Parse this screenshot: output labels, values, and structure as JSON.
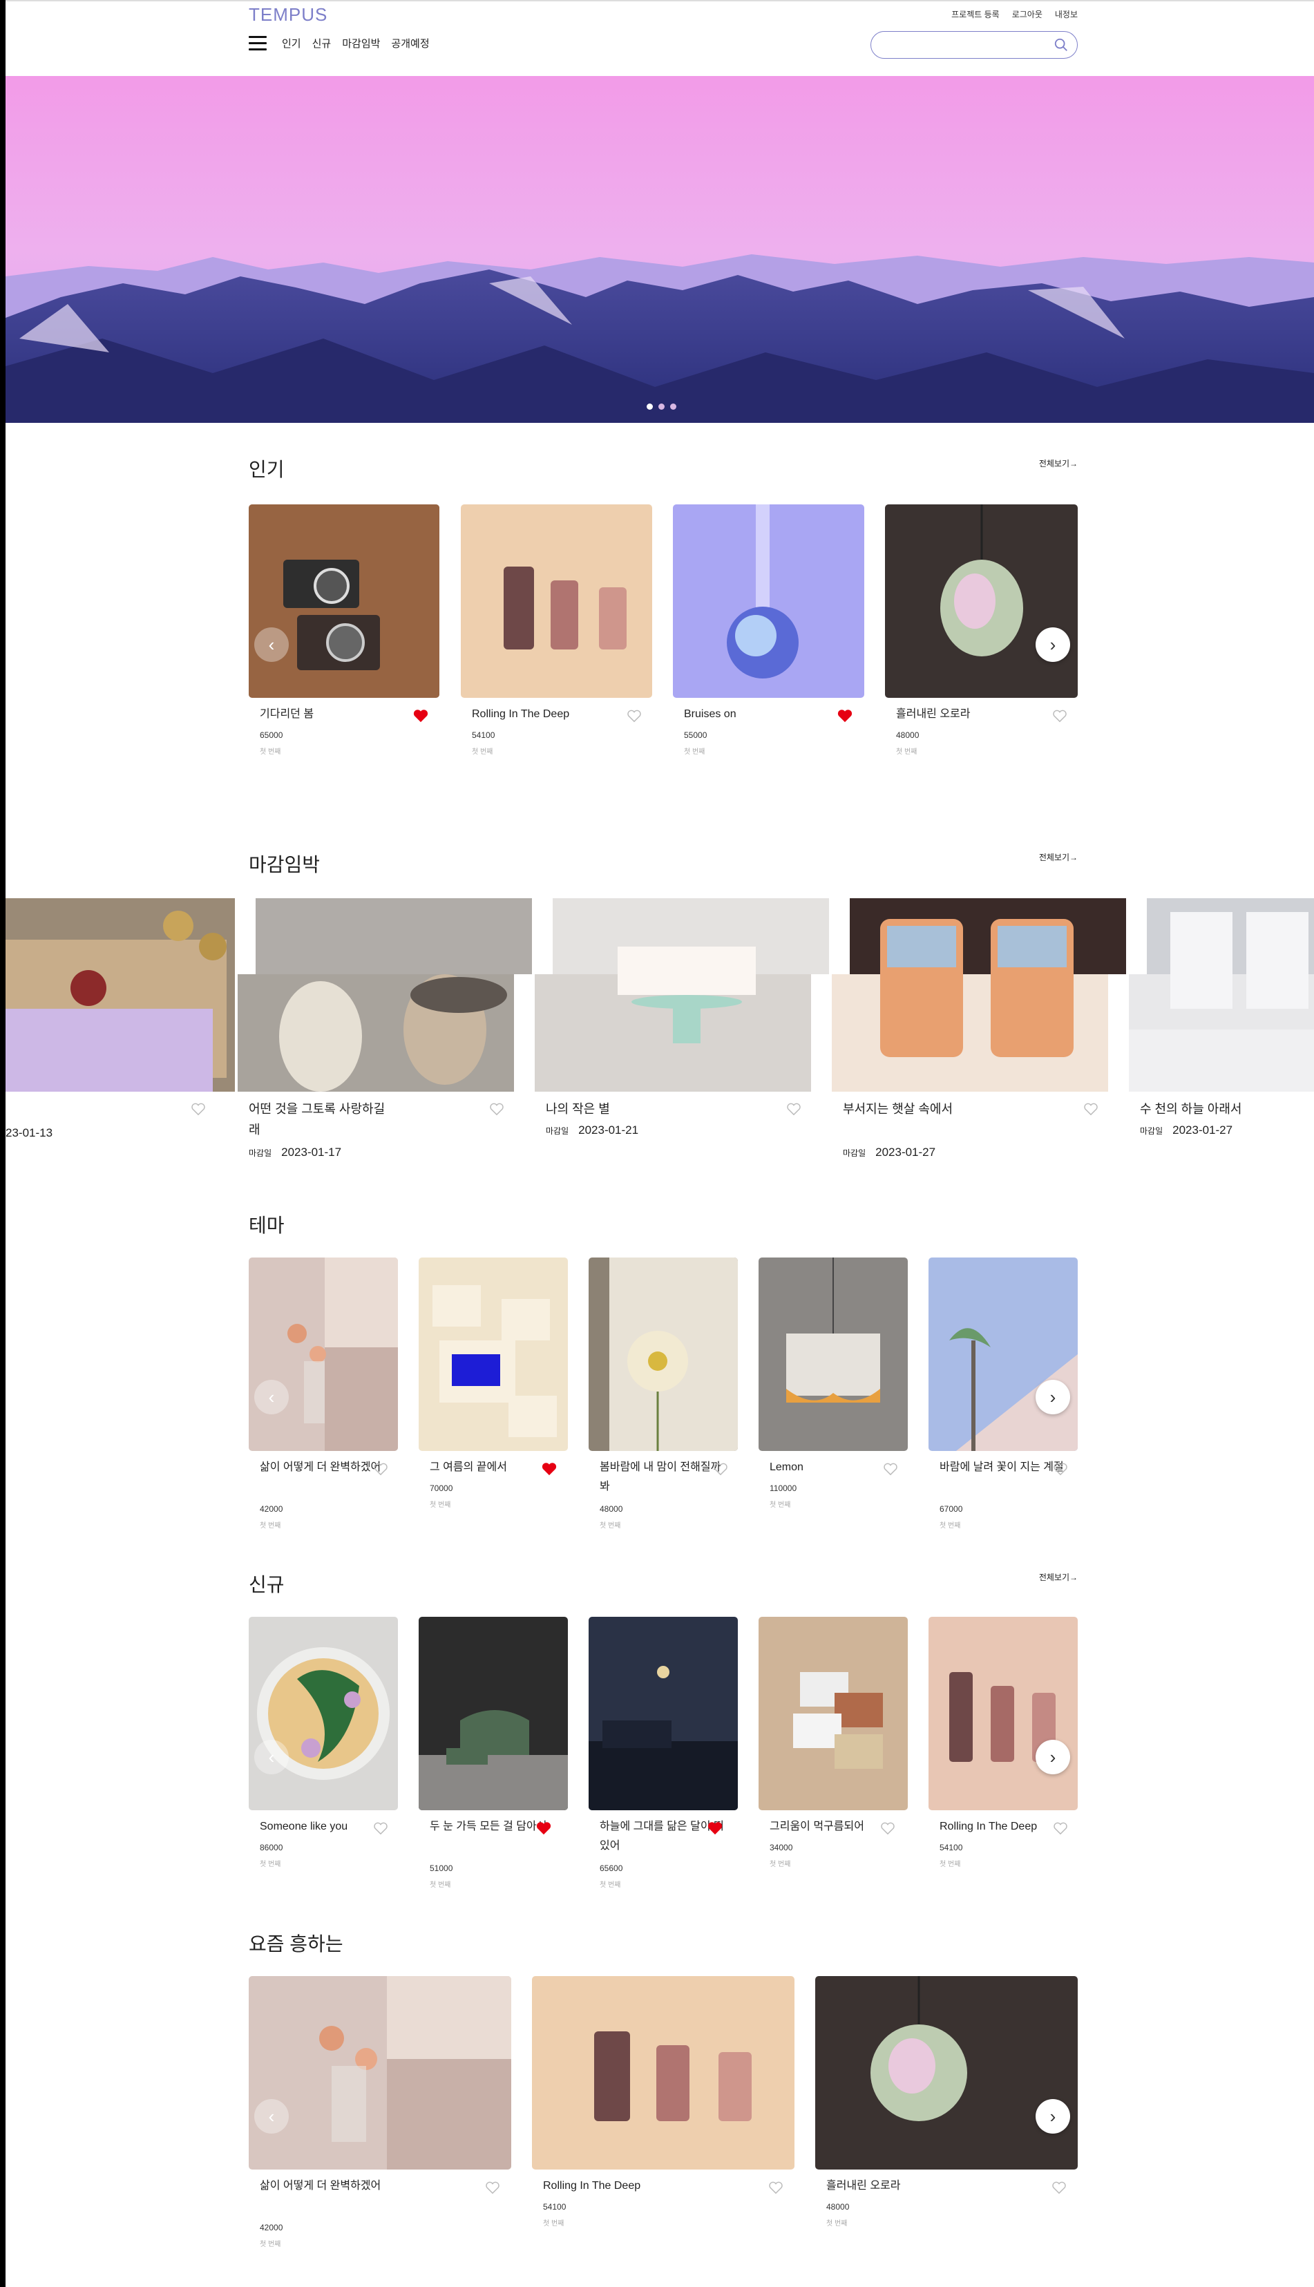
{
  "brand": "TEMPUS",
  "util_links": [
    "프로젝트 등록",
    "로그아웃",
    "내정보"
  ],
  "nav": [
    "인기",
    "신규",
    "마감임박",
    "공개예정"
  ],
  "search": {
    "placeholder": ""
  },
  "colors": {
    "accent": "#7d7fc9",
    "heart_on": "#e60012",
    "heart_off": "#bbbbbb"
  },
  "hero": {
    "slides": 3,
    "active": 0
  },
  "more_label": "전체보기→",
  "sections": {
    "popular": {
      "title": "인기",
      "items": [
        {
          "name": "기다리던 봄",
          "price": "65000",
          "sub": "첫 번째",
          "liked": true
        },
        {
          "name": "Rolling In The Deep",
          "price": "54100",
          "sub": "첫 번째",
          "liked": false
        },
        {
          "name": "Bruises on",
          "price": "55000",
          "sub": "첫 번째",
          "liked": true
        },
        {
          "name": "흘러내린 오로라",
          "price": "48000",
          "sub": "첫 번째",
          "liked": false
        }
      ]
    },
    "deadline": {
      "title": "마감임박",
      "date_label": "마감일",
      "items": [
        {
          "name": "",
          "date": "23-01-13"
        },
        {
          "name": "어떤 것을 그토록 사랑하길래",
          "date": "2023-01-17"
        },
        {
          "name": "나의 작은 별",
          "date": "2023-01-21"
        },
        {
          "name": "부서지는 햇살 속에서",
          "date": "2023-01-27"
        },
        {
          "name": "수 천의 하늘 아래서",
          "date": "2023-01-27"
        }
      ]
    },
    "theme": {
      "title": "테마",
      "items": [
        {
          "name": "삶이 어떻게 더 완벽하겠어",
          "price": "42000",
          "sub": "첫 번째",
          "liked": false
        },
        {
          "name": "그 여름의 끝에서",
          "price": "70000",
          "sub": "첫 번째",
          "liked": true
        },
        {
          "name": "봄바람에 내 맘이 전해질까봐",
          "price": "48000",
          "sub": "첫 번째",
          "liked": false
        },
        {
          "name": "Lemon",
          "price": "110000",
          "sub": "첫 번째",
          "liked": false
        },
        {
          "name": "바람에 날려 꽃이 지는 계절",
          "price": "67000",
          "sub": "첫 번째",
          "liked": false
        }
      ]
    },
    "new": {
      "title": "신규",
      "items": [
        {
          "name": "Someone like you",
          "price": "86000",
          "sub": "첫 번째",
          "liked": false
        },
        {
          "name": "두 눈 가득 모든 걸 담아서",
          "price": "51000",
          "sub": "첫 번째",
          "liked": true
        },
        {
          "name": "하늘에 그대를 닮은 달이 떠있어",
          "price": "65600",
          "sub": "첫 번째",
          "liked": true
        },
        {
          "name": "그리움이 먹구름되어",
          "price": "34000",
          "sub": "첫 번째",
          "liked": false
        },
        {
          "name": "Rolling In The Deep",
          "price": "54100",
          "sub": "첫 번째",
          "liked": false
        }
      ]
    },
    "trending": {
      "title": "요즘 흥하는",
      "items": [
        {
          "name": "삶이 어떻게 더 완벽하겠어",
          "price": "42000",
          "sub": "첫 번째",
          "liked": false
        },
        {
          "name": "Rolling In The Deep",
          "price": "54100",
          "sub": "첫 번째",
          "liked": false
        },
        {
          "name": "흘러내린 오로라",
          "price": "48000",
          "sub": "첫 번째",
          "liked": false
        }
      ]
    }
  }
}
